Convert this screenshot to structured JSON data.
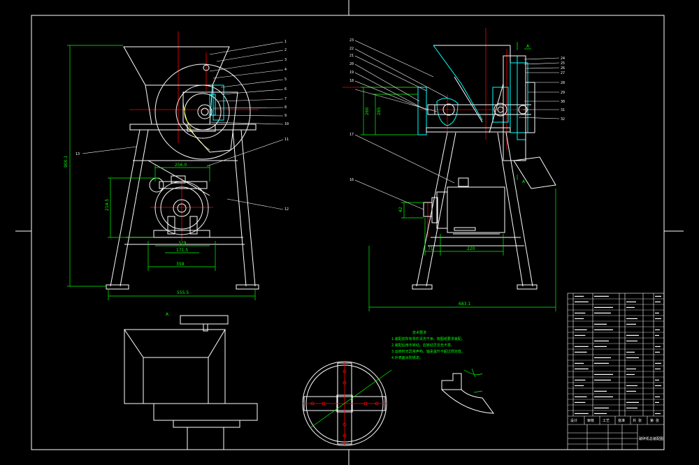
{
  "colors": {
    "background": "#000000",
    "outline": "#ffffff",
    "dimension": "#00ff00",
    "centerline": "#ff0000",
    "section": "#00ffff",
    "hidden": "#ffff00"
  },
  "views": {
    "front": {
      "dims": {
        "overall_height": "900.1",
        "overall_width": "555.5",
        "motor_height": "214.5",
        "motor_base_a": "256.0",
        "motor_base_b": "171.5",
        "motor_base_c": "329",
        "base_width": "359"
      },
      "balloons": [
        "1",
        "2",
        "3",
        "4",
        "5",
        "6",
        "7",
        "8",
        "9",
        "10",
        "11",
        "12",
        "13"
      ]
    },
    "side": {
      "dims": {
        "overall_width": "683.1",
        "hopper_height_a": "260",
        "hopper_height_b": "285",
        "shaft_dim": "42",
        "motor_dim_a": "71",
        "motor_dim_b": "220"
      },
      "balloons_left": [
        "23",
        "22",
        "21",
        "20",
        "19",
        "18",
        "17",
        "16"
      ],
      "balloons_right": [
        "24",
        "25",
        "26",
        "27",
        "28",
        "29",
        "30",
        "31",
        "32"
      ],
      "section_marks": [
        "A",
        "A"
      ]
    },
    "top": {
      "mark": "A"
    }
  },
  "notes": {
    "title": "技术要求",
    "lines": [
      "1.装配前所有零件清洗干净，按图纸要求装配。",
      "2.装配后用手转动，应转动灵活无卡滞。",
      "3.运转时无异常声响，轴承温升不超过规定值。",
      "4.外表面涂防锈漆。"
    ]
  },
  "title_block": {
    "drawing_title": "破碎机总装配图",
    "signature_row": [
      "设计",
      "审核",
      "工艺",
      "批准",
      "共 张",
      "第 张"
    ]
  }
}
